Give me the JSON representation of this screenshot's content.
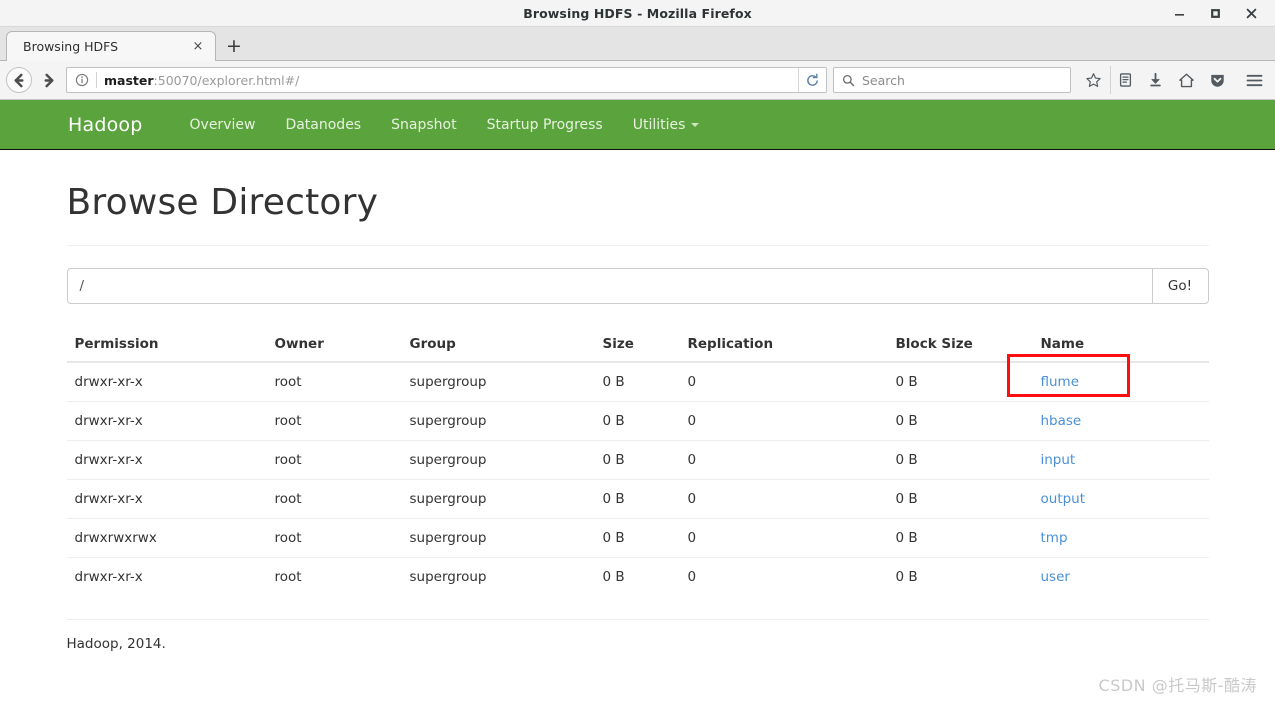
{
  "window": {
    "title": "Browsing HDFS - Mozilla Firefox",
    "minimize_label": "minimize",
    "maximize_label": "maximize",
    "close_label": "close"
  },
  "browser": {
    "tab": {
      "label": "Browsing HDFS",
      "close_glyph": "×"
    },
    "new_tab_glyph": "+",
    "url": {
      "host": "master",
      "rest": ":50070/explorer.html#/"
    },
    "search": {
      "placeholder": "Search",
      "value": ""
    },
    "icons": {
      "back": "back-icon",
      "forward": "forward-icon",
      "identity": "identity-info-icon",
      "reload": "reload-icon",
      "search": "search-icon",
      "bookmark": "star-bookmark-icon",
      "library": "library-icon",
      "downloads": "download-icon",
      "home": "home-icon",
      "pocket": "pocket-shield-icon",
      "menu": "hamburger-menu-icon"
    }
  },
  "hadoop_nav": {
    "brand": "Hadoop",
    "items": [
      {
        "label": "Overview",
        "dropdown": false
      },
      {
        "label": "Datanodes",
        "dropdown": false
      },
      {
        "label": "Snapshot",
        "dropdown": false
      },
      {
        "label": "Startup Progress",
        "dropdown": false
      },
      {
        "label": "Utilities",
        "dropdown": true
      }
    ],
    "background": "#5ba33d"
  },
  "main": {
    "title": "Browse Directory",
    "path_input": {
      "value": "/",
      "placeholder": ""
    },
    "go_label": "Go!",
    "columns": [
      "Permission",
      "Owner",
      "Group",
      "Size",
      "Replication",
      "Block Size",
      "Name"
    ],
    "rows": [
      {
        "permission": "drwxr-xr-x",
        "owner": "root",
        "group": "supergroup",
        "size": "0 B",
        "replication": "0",
        "block_size": "0 B",
        "name": "flume",
        "highlighted": true
      },
      {
        "permission": "drwxr-xr-x",
        "owner": "root",
        "group": "supergroup",
        "size": "0 B",
        "replication": "0",
        "block_size": "0 B",
        "name": "hbase",
        "highlighted": false
      },
      {
        "permission": "drwxr-xr-x",
        "owner": "root",
        "group": "supergroup",
        "size": "0 B",
        "replication": "0",
        "block_size": "0 B",
        "name": "input",
        "highlighted": false
      },
      {
        "permission": "drwxr-xr-x",
        "owner": "root",
        "group": "supergroup",
        "size": "0 B",
        "replication": "0",
        "block_size": "0 B",
        "name": "output",
        "highlighted": false
      },
      {
        "permission": "drwxrwxrwx",
        "owner": "root",
        "group": "supergroup",
        "size": "0 B",
        "replication": "0",
        "block_size": "0 B",
        "name": "tmp",
        "highlighted": false
      },
      {
        "permission": "drwxr-xr-x",
        "owner": "root",
        "group": "supergroup",
        "size": "0 B",
        "replication": "0",
        "block_size": "0 B",
        "name": "user",
        "highlighted": false
      }
    ],
    "highlight_color": "#fd0f0f",
    "link_color": "#4a90d9"
  },
  "footer": {
    "text": "Hadoop, 2014."
  },
  "watermark": {
    "text": "CSDN @托马斯-酷涛"
  }
}
